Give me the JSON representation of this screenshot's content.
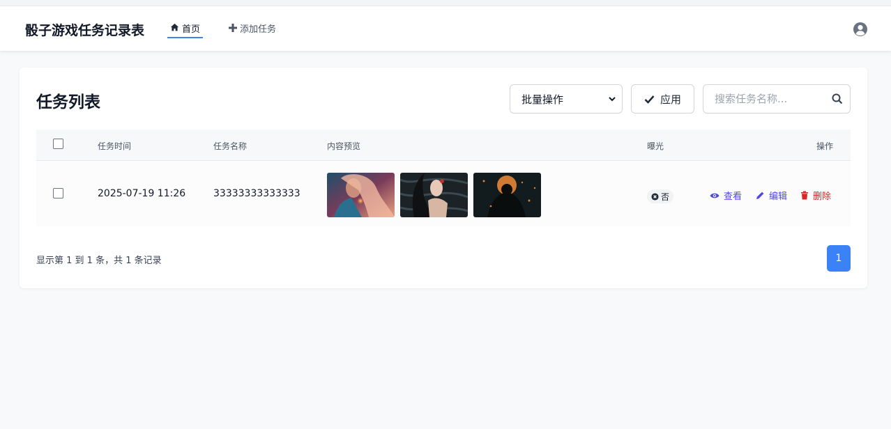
{
  "app": {
    "title": "骰子游戏任务记录表"
  },
  "nav": {
    "home_label": "首页",
    "add_label": "添加任务"
  },
  "card": {
    "title": "任务列表",
    "bulk_select": {
      "selected": "批量操作"
    },
    "apply_label": "应用",
    "search": {
      "placeholder": "搜索任务名称...",
      "value": ""
    }
  },
  "table": {
    "headers": {
      "time": "任务时间",
      "name": "任务名称",
      "preview": "内容预览",
      "exposure": "曝光",
      "actions": "操作"
    },
    "rows": [
      {
        "time": "2025-07-19 11:26",
        "name": "33333333333333",
        "exposure": "否",
        "actions": {
          "view": "查看",
          "edit": "编辑",
          "delete": "删除"
        }
      }
    ]
  },
  "footer": {
    "summary": "显示第 1 到 1 条，共 1 条记录",
    "current_page": "1"
  },
  "colors": {
    "accent": "#3b82f6",
    "action_link": "#4f46e5",
    "danger": "#dc2626"
  },
  "icons": [
    "home-icon",
    "plus-icon",
    "user-circle-icon",
    "chevron-down-icon",
    "check-icon",
    "search-icon",
    "times-circle-icon",
    "eye-icon",
    "pencil-icon",
    "trash-icon"
  ]
}
